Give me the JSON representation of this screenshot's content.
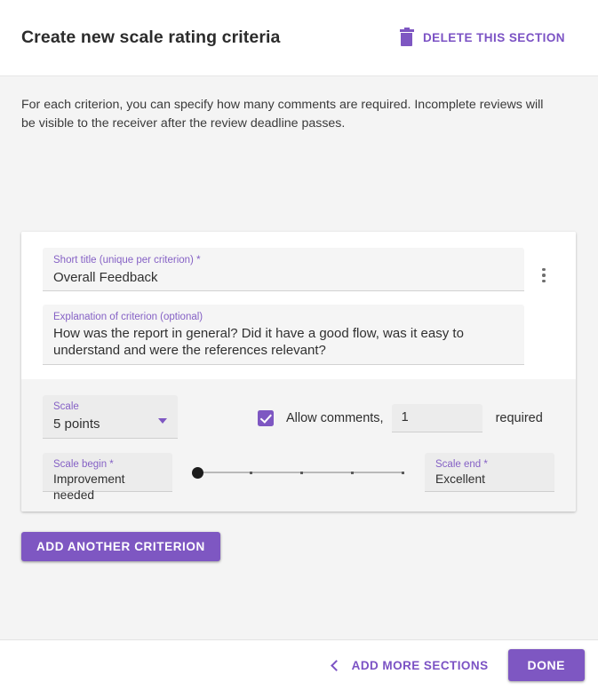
{
  "header": {
    "title": "Create new scale rating criteria",
    "delete_label": "DELETE THIS SECTION",
    "trash_icon": "trash-icon"
  },
  "intro": {
    "text": "For each criterion, you can specify how many comments are required. Incomplete reviews will be visible to the receiver after the review deadline passes."
  },
  "criterion": {
    "menu_icon": "kebab-menu-icon",
    "short_title": {
      "label": "Short title (unique per criterion) *",
      "value": "Overall Feedback",
      "placeholder": "Short title (unique per criterion)"
    },
    "explanation": {
      "label": "Explanation of criterion (optional)",
      "value": "How was the report in general?  Did it have a good flow, was it easy to understand and were the references relevant?",
      "placeholder": "Explanation of criterion (optional)"
    },
    "scale": {
      "label": "Scale",
      "value": "5 points",
      "caret_icon": "chevron-down-icon",
      "options": [
        "5 points"
      ]
    },
    "comments": {
      "checkbox_checked": true,
      "checkbox_icon": "check-icon",
      "allow_label": "Allow comments,",
      "count_value": "1",
      "count_placeholder": "1",
      "required_label": "required"
    },
    "scale_begin": {
      "label": "Scale begin *",
      "value": "Improvement needed",
      "placeholder": "Scale begin"
    },
    "scale_end": {
      "label": "Scale end *",
      "value": "Excellent",
      "placeholder": "Scale end"
    },
    "slider": {
      "points": 5,
      "thumb_position": 0,
      "tick_count": 4
    }
  },
  "actions": {
    "add_criterion_label": "ADD ANOTHER CRITERION"
  },
  "footer": {
    "back_icon": "chevron-left-icon",
    "add_sections_label": "ADD MORE SECTIONS",
    "done_label": "DONE"
  },
  "colors": {
    "accent": "#7e57c2",
    "accent_text": "#7b52c4",
    "label": "#8561c5",
    "page_bg": "#f4f4f4",
    "card_bg": "#ffffff",
    "field_bg": "#f5f5f5"
  }
}
